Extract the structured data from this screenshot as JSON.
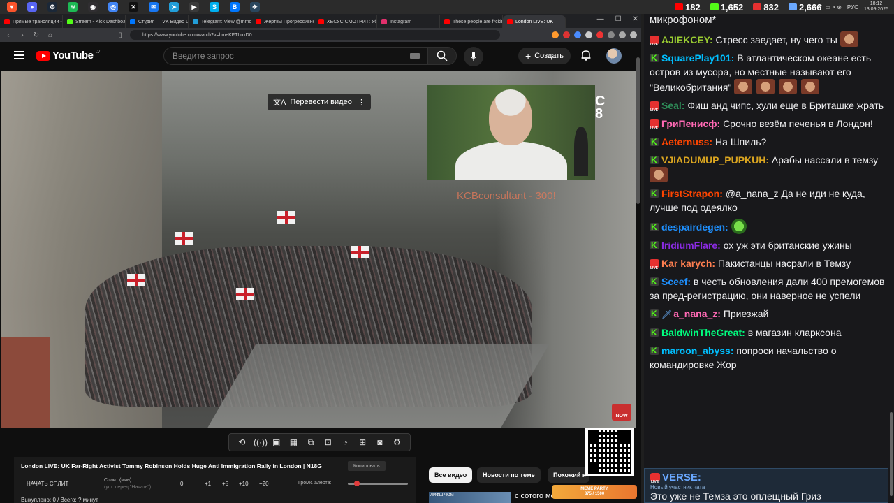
{
  "taskbar": {
    "apps": [
      {
        "icon": "brave-icon",
        "color": "#fb542b",
        "glyph": "▼"
      },
      {
        "icon": "discord-icon",
        "color": "#5865f2",
        "glyph": "●"
      },
      {
        "icon": "steam-icon",
        "color": "#1b2838",
        "glyph": "⚙"
      },
      {
        "icon": "spotify-icon",
        "color": "#1db954",
        "glyph": "≋"
      },
      {
        "icon": "obs-icon",
        "color": "#302e31",
        "glyph": "◉"
      },
      {
        "icon": "chrome-icon",
        "color": "#4285f4",
        "glyph": "◎"
      },
      {
        "icon": "epic-icon",
        "color": "#111111",
        "glyph": "✕"
      },
      {
        "icon": "messenger-icon",
        "color": "#1877f2",
        "glyph": "✉"
      },
      {
        "icon": "telegram-icon",
        "color": "#229ed9",
        "glyph": "➤"
      },
      {
        "icon": "stream-app-icon",
        "color": "#3a3a3a",
        "glyph": "▶"
      },
      {
        "icon": "skype-icon",
        "color": "#00aff0",
        "glyph": "S"
      },
      {
        "icon": "vk-icon",
        "color": "#0077ff",
        "glyph": "В"
      },
      {
        "icon": "steam-2-icon",
        "color": "#2a475e",
        "glyph": "✈"
      }
    ],
    "lang": "РУС",
    "time": "18:12",
    "date": "13.09.2025"
  },
  "browser": {
    "tabs": [
      {
        "label": "Прямые трансляции - Y",
        "color": "#ff0000"
      },
      {
        "label": "Stream - Kick Dashboard",
        "color": "#53fc18"
      },
      {
        "label": "Студия — VK Видео Live",
        "color": "#0077ff"
      },
      {
        "label": "Telegram: View @mmoq",
        "color": "#229ed9"
      },
      {
        "label": "Жертвы Прогрессивно...",
        "color": "#ff0000"
      },
      {
        "label": "ХЕСУС СМОТРИТ: Убий",
        "color": "#ff0000"
      },
      {
        "label": "Instagram",
        "color": "#e1306c"
      },
      {
        "label": "These people are f*ckin",
        "color": "#ff0000"
      },
      {
        "label": "London LIVE: UK",
        "color": "#ff0000"
      }
    ],
    "active_tab": 8,
    "url": "https://www.youtube.com/watch?v=bmeKFTLoxD0"
  },
  "youtube": {
    "logo": "YouTube",
    "country": "LV",
    "search_placeholder": "Введите запрос",
    "create_label": "Создать",
    "translate_label": "Перевести видео",
    "donation_overlay": "KCBconsultant - 300!",
    "channel_mark": "C\n8",
    "now_badge": "NOW",
    "video_title": "London LIVE: UK Far-Right Activist Tommy Robinson Holds Huge Anti Immigration Rally in London | N18G",
    "copy_label": "Копировать",
    "split_label": "НАЧАТЬ СПЛИТ",
    "split_min_label": "Сплит (мин):",
    "split_min_sub": "(уст. перед \"Начать\")",
    "split_values": [
      "0",
      "+1",
      "+5",
      "+10",
      "+20"
    ],
    "alert_label": "Громк. алерта:",
    "alert_level": 0.1,
    "bought_text": "Выкуплено: 0 / Всего: ? минут",
    "chips": [
      "Все видео",
      "Новости по теме",
      "Похожий к"
    ],
    "rec_thumb_text": "ЛИФШ ЧОМ",
    "rec_title": "с сотого места",
    "meme_title": "MEME PARTY",
    "meme_progress": "875 / 1500"
  },
  "chat": {
    "stats": [
      {
        "icon": "youtube-viewers-icon",
        "color": "#ff0000",
        "value": "182"
      },
      {
        "icon": "kick-viewers-icon",
        "color": "#53fc18",
        "value": "1,652"
      },
      {
        "icon": "vk-live-viewers-icon",
        "color": "#e53030",
        "value": "832"
      },
      {
        "icon": "total-viewers-icon",
        "color": "#6aa8ff",
        "value": "2,666"
      }
    ],
    "header_text": "микрофоном*",
    "messages": [
      {
        "platform": "live",
        "user": "AJIEKCEY:",
        "color": "#9acd32",
        "text": "Стресс заедает, ну чего ты",
        "emotes": 1
      },
      {
        "platform": "kick",
        "user": "SquarePlay101:",
        "color": "#00bfff",
        "text": "В атлантическом океане есть остров из мусора, но местные называют его \"Великобритания\"",
        "emotes": 4
      },
      {
        "platform": "live",
        "user": "Seal:",
        "color": "#2e8b57",
        "text": "Фиш анд чипс, хули еще в Бриташке жрать",
        "emotes": 0
      },
      {
        "platform": "live",
        "user": "ГриПенисф:",
        "color": "#ff69b4",
        "text": "Срочно везём печенья в Лондон!",
        "emotes": 0
      },
      {
        "platform": "kick",
        "user": "Aeternuss:",
        "color": "#ff4500",
        "text": "На Шпиль?",
        "emotes": 0
      },
      {
        "platform": "kick",
        "user": "VJIADUMUP_PUPKUH:",
        "color": "#daa520",
        "text": "Арабы нассали в темзу",
        "emotes": 1
      },
      {
        "platform": "kick",
        "user": "FirstStrapon:",
        "color": "#ff4500",
        "text": "@a_nana_z Да не иди не куда, лучше под одеялко",
        "emotes": 0
      },
      {
        "platform": "kick",
        "user": "despairdegen:",
        "color": "#1e90ff",
        "text": "",
        "emotes": 0,
        "green": true
      },
      {
        "platform": "kick",
        "user": "IridiumFlare:",
        "color": "#8a2be2",
        "text": "ох уж эти британские ужины",
        "emotes": 0
      },
      {
        "platform": "live",
        "user": "Kar karych:",
        "color": "#ff7f50",
        "text": "Пакистанцы насрали в Темзу",
        "emotes": 0
      },
      {
        "platform": "kick",
        "user": "Sceef:",
        "color": "#1e90ff",
        "text": "в честь обновления дали 400 премогемов за пред-регистрацию, они наверное не успели",
        "emotes": 0
      },
      {
        "platform": "kick",
        "user": "a_nana_z:",
        "color": "#ff69b4",
        "text": "Приезжай",
        "emotes": 0,
        "sword": true
      },
      {
        "platform": "kick",
        "user": "BaldwinTheGreat:",
        "color": "#00ff7f",
        "text": "в магазин кларксона",
        "emotes": 0
      },
      {
        "platform": "kick",
        "user": "maroon_abyss:",
        "color": "#00bfff",
        "text": "попроси начальство о командировке Жор",
        "emotes": 0
      }
    ],
    "highlight": {
      "user": "VERSE:",
      "sub": "Новый участник чата",
      "text": "Это уже не Темза это оплещный Гриз"
    }
  }
}
